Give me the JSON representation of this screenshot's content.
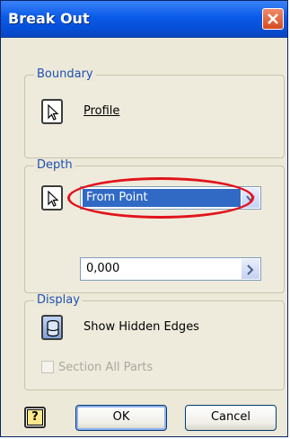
{
  "window": {
    "title": "Break Out"
  },
  "boundary": {
    "group_label": "Boundary",
    "profile_label": "Profile"
  },
  "depth": {
    "group_label": "Depth",
    "selected_option": "From Point",
    "distance_value": "0,000"
  },
  "display": {
    "group_label": "Display",
    "show_hidden_edges_label": "Show Hidden Edges",
    "section_all_parts_label": "Section All Parts",
    "section_all_parts_checked": false
  },
  "buttons": {
    "help_label": "?",
    "ok_label": "OK",
    "cancel_label": "Cancel"
  },
  "colors": {
    "titlebar": "#0a5ae8",
    "group_label": "#1e50b4",
    "selection": "#316ac5",
    "annotation": "#e2141b"
  },
  "icons": {
    "close": "close-icon",
    "pick": "cursor-arrow-icon",
    "dropdown": "chevron-down-icon",
    "expand": "chevron-right-icon",
    "hidden_edges": "cylinder-icon",
    "help": "help-icon"
  }
}
